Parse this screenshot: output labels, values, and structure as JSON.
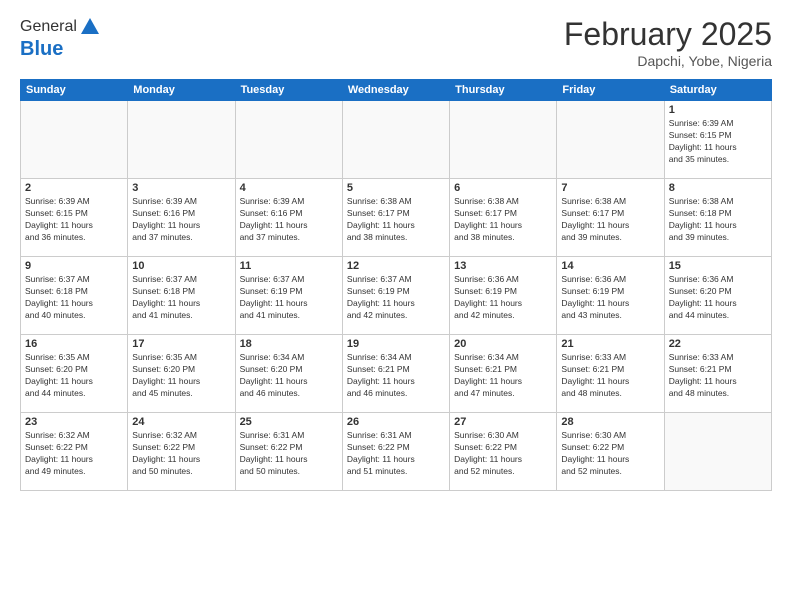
{
  "logo": {
    "general": "General",
    "blue": "Blue"
  },
  "title": "February 2025",
  "location": "Dapchi, Yobe, Nigeria",
  "headers": [
    "Sunday",
    "Monday",
    "Tuesday",
    "Wednesday",
    "Thursday",
    "Friday",
    "Saturday"
  ],
  "weeks": [
    [
      {
        "day": "",
        "info": ""
      },
      {
        "day": "",
        "info": ""
      },
      {
        "day": "",
        "info": ""
      },
      {
        "day": "",
        "info": ""
      },
      {
        "day": "",
        "info": ""
      },
      {
        "day": "",
        "info": ""
      },
      {
        "day": "1",
        "info": "Sunrise: 6:39 AM\nSunset: 6:15 PM\nDaylight: 11 hours\nand 35 minutes."
      }
    ],
    [
      {
        "day": "2",
        "info": "Sunrise: 6:39 AM\nSunset: 6:15 PM\nDaylight: 11 hours\nand 36 minutes."
      },
      {
        "day": "3",
        "info": "Sunrise: 6:39 AM\nSunset: 6:16 PM\nDaylight: 11 hours\nand 37 minutes."
      },
      {
        "day": "4",
        "info": "Sunrise: 6:39 AM\nSunset: 6:16 PM\nDaylight: 11 hours\nand 37 minutes."
      },
      {
        "day": "5",
        "info": "Sunrise: 6:38 AM\nSunset: 6:17 PM\nDaylight: 11 hours\nand 38 minutes."
      },
      {
        "day": "6",
        "info": "Sunrise: 6:38 AM\nSunset: 6:17 PM\nDaylight: 11 hours\nand 38 minutes."
      },
      {
        "day": "7",
        "info": "Sunrise: 6:38 AM\nSunset: 6:17 PM\nDaylight: 11 hours\nand 39 minutes."
      },
      {
        "day": "8",
        "info": "Sunrise: 6:38 AM\nSunset: 6:18 PM\nDaylight: 11 hours\nand 39 minutes."
      }
    ],
    [
      {
        "day": "9",
        "info": "Sunrise: 6:37 AM\nSunset: 6:18 PM\nDaylight: 11 hours\nand 40 minutes."
      },
      {
        "day": "10",
        "info": "Sunrise: 6:37 AM\nSunset: 6:18 PM\nDaylight: 11 hours\nand 41 minutes."
      },
      {
        "day": "11",
        "info": "Sunrise: 6:37 AM\nSunset: 6:19 PM\nDaylight: 11 hours\nand 41 minutes."
      },
      {
        "day": "12",
        "info": "Sunrise: 6:37 AM\nSunset: 6:19 PM\nDaylight: 11 hours\nand 42 minutes."
      },
      {
        "day": "13",
        "info": "Sunrise: 6:36 AM\nSunset: 6:19 PM\nDaylight: 11 hours\nand 42 minutes."
      },
      {
        "day": "14",
        "info": "Sunrise: 6:36 AM\nSunset: 6:19 PM\nDaylight: 11 hours\nand 43 minutes."
      },
      {
        "day": "15",
        "info": "Sunrise: 6:36 AM\nSunset: 6:20 PM\nDaylight: 11 hours\nand 44 minutes."
      }
    ],
    [
      {
        "day": "16",
        "info": "Sunrise: 6:35 AM\nSunset: 6:20 PM\nDaylight: 11 hours\nand 44 minutes."
      },
      {
        "day": "17",
        "info": "Sunrise: 6:35 AM\nSunset: 6:20 PM\nDaylight: 11 hours\nand 45 minutes."
      },
      {
        "day": "18",
        "info": "Sunrise: 6:34 AM\nSunset: 6:20 PM\nDaylight: 11 hours\nand 46 minutes."
      },
      {
        "day": "19",
        "info": "Sunrise: 6:34 AM\nSunset: 6:21 PM\nDaylight: 11 hours\nand 46 minutes."
      },
      {
        "day": "20",
        "info": "Sunrise: 6:34 AM\nSunset: 6:21 PM\nDaylight: 11 hours\nand 47 minutes."
      },
      {
        "day": "21",
        "info": "Sunrise: 6:33 AM\nSunset: 6:21 PM\nDaylight: 11 hours\nand 48 minutes."
      },
      {
        "day": "22",
        "info": "Sunrise: 6:33 AM\nSunset: 6:21 PM\nDaylight: 11 hours\nand 48 minutes."
      }
    ],
    [
      {
        "day": "23",
        "info": "Sunrise: 6:32 AM\nSunset: 6:22 PM\nDaylight: 11 hours\nand 49 minutes."
      },
      {
        "day": "24",
        "info": "Sunrise: 6:32 AM\nSunset: 6:22 PM\nDaylight: 11 hours\nand 50 minutes."
      },
      {
        "day": "25",
        "info": "Sunrise: 6:31 AM\nSunset: 6:22 PM\nDaylight: 11 hours\nand 50 minutes."
      },
      {
        "day": "26",
        "info": "Sunrise: 6:31 AM\nSunset: 6:22 PM\nDaylight: 11 hours\nand 51 minutes."
      },
      {
        "day": "27",
        "info": "Sunrise: 6:30 AM\nSunset: 6:22 PM\nDaylight: 11 hours\nand 52 minutes."
      },
      {
        "day": "28",
        "info": "Sunrise: 6:30 AM\nSunset: 6:22 PM\nDaylight: 11 hours\nand 52 minutes."
      },
      {
        "day": "",
        "info": ""
      }
    ]
  ]
}
